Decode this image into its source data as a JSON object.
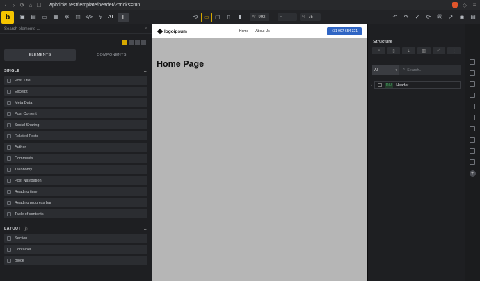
{
  "browser": {
    "url": "wpbricks.test/template/header/?bricks=run",
    "nav_back": "‹",
    "nav_forward": "›",
    "icons": [
      "back-icon",
      "forward-icon",
      "reload-icon",
      "home-icon",
      "bookmark-icon",
      "brave-shield-icon"
    ]
  },
  "toolbar": {
    "logo": "b",
    "at_label": "AT",
    "plus_label": "+",
    "width_label": "W",
    "width_value": "992",
    "height_label": "H",
    "height_value": "",
    "zoom_label": "%",
    "zoom_value": "75"
  },
  "left_panel": {
    "search_placeholder": "Search elements ...",
    "tabs": [
      "ELEMENTS",
      "COMPONENTS"
    ],
    "single_heading": "SINGLE",
    "single_items": [
      "Post Title",
      "Excerpt",
      "Meta Data",
      "Post Content",
      "Social Sharing",
      "Related Posts",
      "Author",
      "Comments",
      "Taxonomy",
      "Post Navigation",
      "Reading time",
      "Reading progress bar",
      "Table of contents"
    ],
    "layout_heading": "LAYOUT",
    "layout_items": [
      "Section",
      "Container",
      "Block"
    ]
  },
  "canvas": {
    "site_logo": "logoipsum",
    "nav": [
      "Home",
      "About Us"
    ],
    "cta": "+31 997 654 321",
    "page_title": "Home Page"
  },
  "structure": {
    "title": "Structure",
    "filter_value": "All",
    "search_placeholder": "Search...",
    "tree": [
      {
        "tag": "DIV",
        "label": "Header"
      }
    ]
  },
  "colors": {
    "accent": "#f5c400",
    "cta": "#2f65c4",
    "canvas_bg": "#b6b6b6"
  }
}
